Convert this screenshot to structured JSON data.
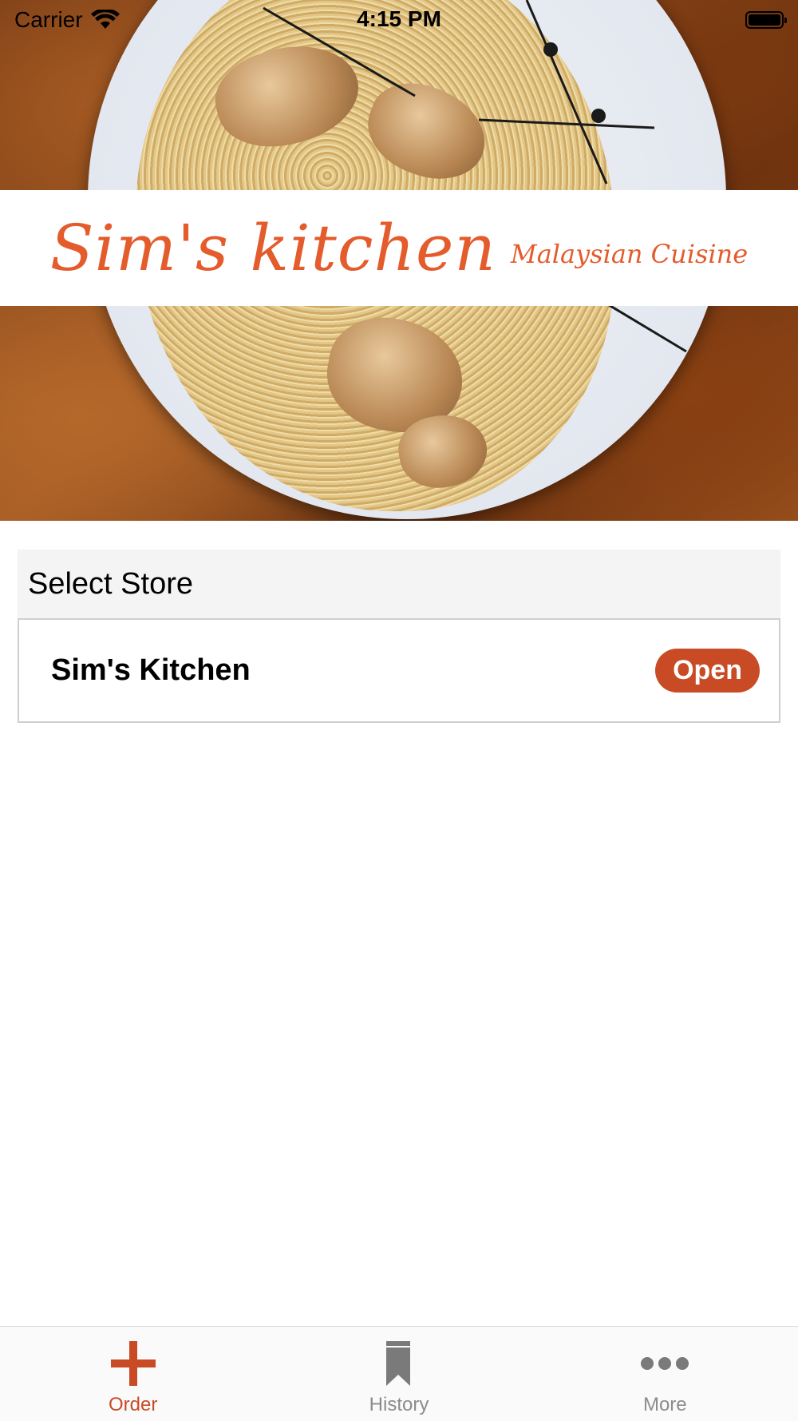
{
  "status_bar": {
    "carrier": "Carrier",
    "time": "4:15 PM"
  },
  "hero": {
    "logo_main": "Sim's kitchen",
    "logo_sub": "Malaysian Cuisine"
  },
  "store_list": {
    "header": "Select Store",
    "stores": [
      {
        "name": "Sim's Kitchen",
        "status": "Open"
      }
    ]
  },
  "tab_bar": {
    "tabs": [
      {
        "label": "Order",
        "icon": "plus-icon",
        "active": true
      },
      {
        "label": "History",
        "icon": "bookmark-icon",
        "active": false
      },
      {
        "label": "More",
        "icon": "more-icon",
        "active": false
      }
    ]
  },
  "colors": {
    "accent": "#c94b26",
    "logo": "#e45b2c",
    "inactive": "#8c8c8c"
  }
}
